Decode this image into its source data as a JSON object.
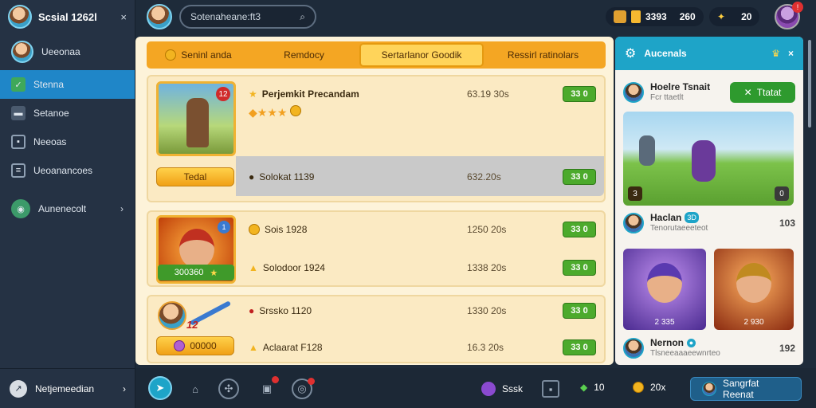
{
  "sidebar": {
    "title": "Scsial 1262l",
    "close": "×",
    "profile_name": "Ueeonaa",
    "items": [
      {
        "label": "Stenna",
        "icon": "shield-icon"
      },
      {
        "label": "Setanoe",
        "icon": "chat-icon"
      },
      {
        "label": "Neeoas",
        "icon": "map-icon"
      },
      {
        "label": "Ueoanancoes",
        "icon": "list-icon"
      },
      {
        "label": "Aunenecolt",
        "icon": "globe-icon"
      }
    ],
    "bottom_label": "Netjemeedian"
  },
  "topbar": {
    "search_text": "Sotenaheane:ft3",
    "resources": [
      {
        "value": "3393",
        "value2": "260"
      },
      {
        "value": "20"
      }
    ],
    "badge": "!"
  },
  "main": {
    "tabs": [
      {
        "label": "Seninl anda"
      },
      {
        "label": "Remdocy"
      },
      {
        "label": "Sertarlanor Goodik"
      },
      {
        "label": "Ressirl ratinolars"
      }
    ],
    "cards": [
      {
        "portrait_badge": "12",
        "button": "Tedal",
        "rows": [
          {
            "name": "Perjemkit Precandam",
            "time": "63.19 30s",
            "action": "33 0"
          },
          {
            "name": "Solokat 1139",
            "time": "632.20s",
            "action": "33 0"
          }
        ]
      },
      {
        "portrait_badge": "1",
        "button": "300360",
        "rows": [
          {
            "name": "Sois 1928",
            "time": "1250 20s",
            "action": "33 0"
          },
          {
            "name": "Solodoor 1924",
            "time": "1338 20s",
            "action": "33 0"
          }
        ]
      },
      {
        "portrait_badge": "12",
        "button": "00000",
        "rows": [
          {
            "name": "Srssko 1120",
            "time": "1330 20s",
            "action": "33 0"
          },
          {
            "name": "Aclaarat F128",
            "time": "16.3 20s",
            "action": "33 0"
          }
        ]
      }
    ]
  },
  "right_panel": {
    "title": "Aucenals",
    "close": "×",
    "users": [
      {
        "name": "Hoelre Tsnait",
        "sub": "Fcr ttaetlt",
        "button": "Ttatat"
      },
      {
        "name": "Haclan",
        "sub": "Tenorutaeeeteot",
        "count": "103",
        "badge": "3D"
      },
      {
        "name": "Nernon",
        "sub": "Tlsneeaaaeewnrteo",
        "count": "192"
      }
    ],
    "scene_labels": [
      "3",
      "0"
    ],
    "tile_labels": [
      "2 335",
      "2 930"
    ]
  },
  "bottom_bar": {
    "stats": [
      {
        "label": "Sssk"
      },
      {
        "label": "10"
      },
      {
        "label": "20x"
      }
    ],
    "button": "Sangrfat Reenat"
  },
  "colors": {
    "accent": "#1ea4c8",
    "tab_bar": "#f4a623",
    "green": "#4caa2c",
    "sidebar": "#253244"
  }
}
